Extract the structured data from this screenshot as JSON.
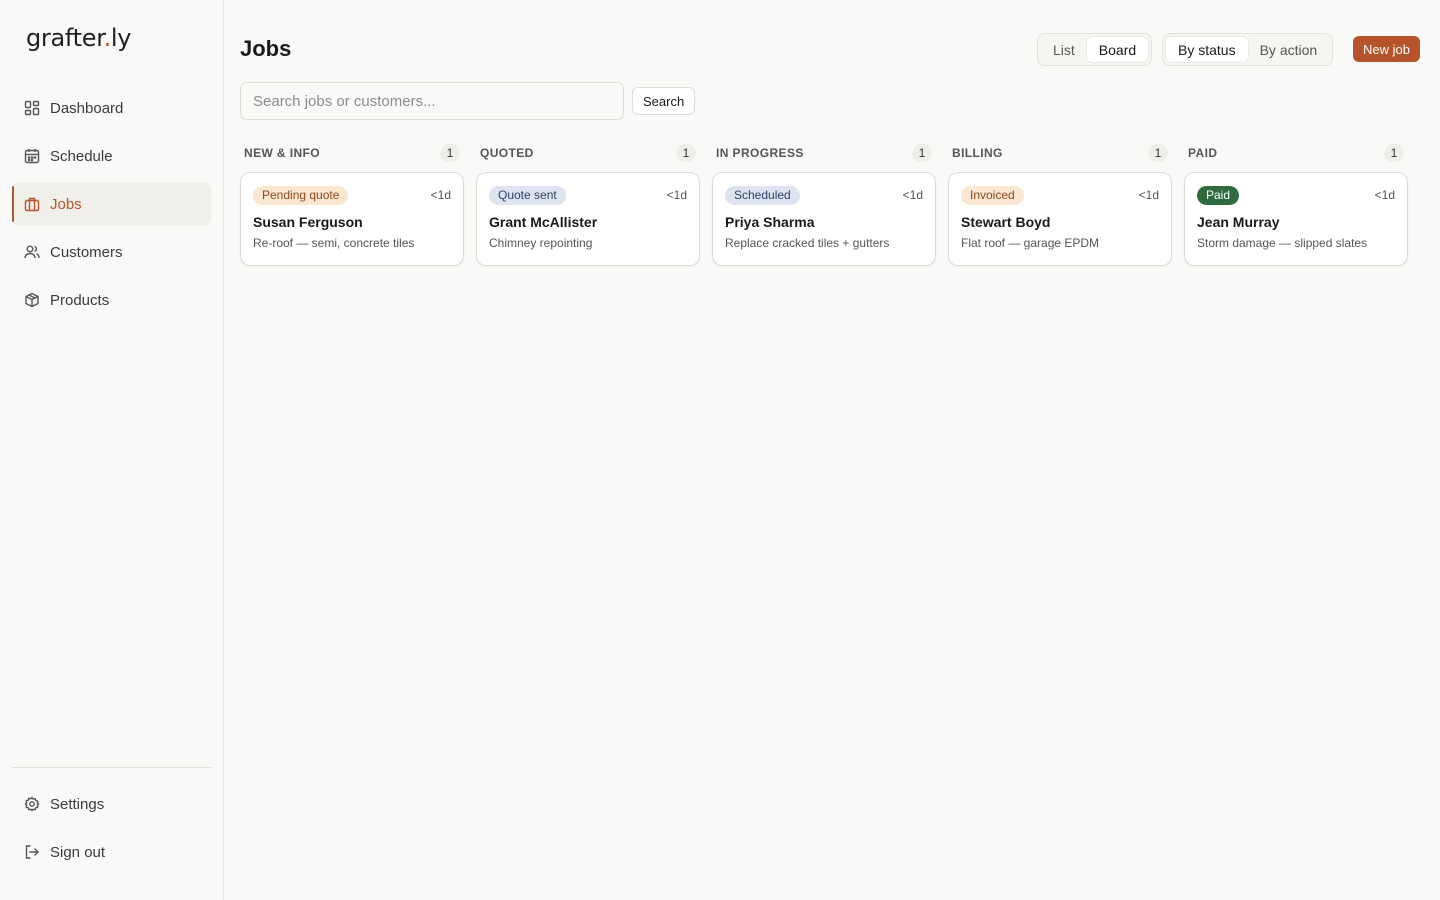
{
  "app": {
    "logo_main": "grafter",
    "logo_dot": ".",
    "logo_tail": "ly"
  },
  "sidebar": {
    "items": [
      {
        "label": "Dashboard",
        "icon": "dashboard-icon"
      },
      {
        "label": "Schedule",
        "icon": "calendar-icon"
      },
      {
        "label": "Jobs",
        "icon": "briefcase-icon",
        "active": true
      },
      {
        "label": "Customers",
        "icon": "users-icon"
      },
      {
        "label": "Products",
        "icon": "box-icon"
      }
    ],
    "bottom": [
      {
        "label": "Settings",
        "icon": "gear-icon"
      },
      {
        "label": "Sign out",
        "icon": "sign-out-icon"
      }
    ]
  },
  "header": {
    "title": "Jobs",
    "view_options": [
      "List",
      "Board"
    ],
    "view_selected": "Board",
    "group_options": [
      "By status",
      "By action"
    ],
    "group_selected": "By status",
    "new_job": "New job"
  },
  "search": {
    "placeholder": "Search jobs or customers...",
    "value": "",
    "button": "Search"
  },
  "colors": {
    "accent": "#b5532a"
  },
  "board": {
    "columns": [
      {
        "title": "NEW & INFO",
        "count": "1",
        "cards": [
          {
            "status": "Pending quote",
            "status_bg": "#fbe6d2",
            "status_fg": "#8a4a1f",
            "age": "<1d",
            "customer": "Susan Ferguson",
            "description": "Re-roof — semi, concrete tiles"
          }
        ]
      },
      {
        "title": "QUOTED",
        "count": "1",
        "cards": [
          {
            "status": "Quote sent",
            "status_bg": "#dde3f0",
            "status_fg": "#2f3f66",
            "age": "<1d",
            "customer": "Grant McAllister",
            "description": "Chimney repointing"
          }
        ]
      },
      {
        "title": "IN PROGRESS",
        "count": "1",
        "cards": [
          {
            "status": "Scheduled",
            "status_bg": "#dde3f0",
            "status_fg": "#2f3f66",
            "age": "<1d",
            "customer": "Priya Sharma",
            "description": "Replace cracked tiles + gutters"
          }
        ]
      },
      {
        "title": "BILLING",
        "count": "1",
        "cards": [
          {
            "status": "Invoiced",
            "status_bg": "#fbe6d2",
            "status_fg": "#8a4a1f",
            "age": "<1d",
            "customer": "Stewart Boyd",
            "description": "Flat roof — garage EPDM"
          }
        ]
      },
      {
        "title": "PAID",
        "count": "1",
        "cards": [
          {
            "status": "Paid",
            "status_bg": "#2f6b3f",
            "status_fg": "#ffffff",
            "age": "<1d",
            "customer": "Jean Murray",
            "description": "Storm damage — slipped slates"
          }
        ]
      }
    ]
  }
}
